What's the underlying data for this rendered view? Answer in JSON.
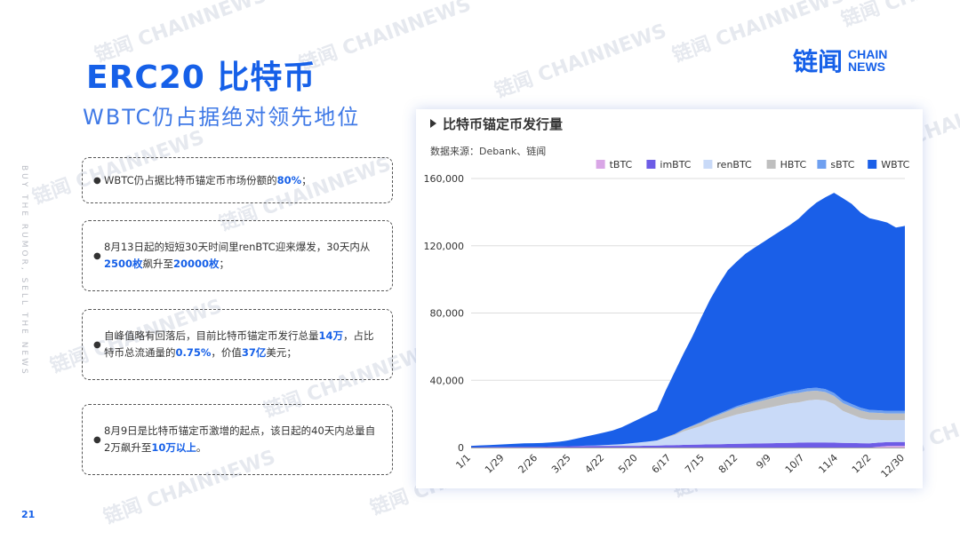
{
  "side_text": "BUY THE RUMOR, SELL THE NEWS",
  "watermark_text": "链闻 CHAINNEWS",
  "title": "ERC20 比特币",
  "subtitle": "WBTC仍占据绝对领先地位",
  "logo": {
    "cn": "链闻",
    "en_line1": "CHAIN",
    "en_line2": "NEWS"
  },
  "page_number": "21",
  "cards": [
    {
      "parts": [
        {
          "t": "WBTC仍占据比特币锚定币市场份额的"
        },
        {
          "t": "80%",
          "hl": true
        },
        {
          "t": "；"
        }
      ]
    },
    {
      "parts": [
        {
          "t": "8月13日起的短短30天时间里renBTC迎来爆发，30天内从"
        },
        {
          "t": "2500枚",
          "hl": true
        },
        {
          "t": "飙升至"
        },
        {
          "t": "20000枚",
          "hl": true
        },
        {
          "t": "；"
        }
      ]
    },
    {
      "parts": [
        {
          "t": "自峰值略有回落后，目前比特币锚定币发行总量"
        },
        {
          "t": "14万",
          "hl": true
        },
        {
          "t": "，占比特币总流通量的"
        },
        {
          "t": "0.75%",
          "hl": true
        },
        {
          "t": "，价值"
        },
        {
          "t": "37亿",
          "hl": true
        },
        {
          "t": "美元；"
        }
      ]
    },
    {
      "parts": [
        {
          "t": "8月9日是比特币锚定币激增的起点，该日起的40天内总量自2万飙升至"
        },
        {
          "t": "10万以上",
          "hl": true
        },
        {
          "t": "。"
        }
      ]
    }
  ],
  "chart_data": {
    "type": "area",
    "stacked": true,
    "title": "比特币锚定币发行量",
    "source": "数据来源：Debank、链闻",
    "legend_position": "top-right",
    "grid": true,
    "ylim": [
      0,
      160000
    ],
    "y_ticks": [
      "0",
      "40,000",
      "80,000",
      "120,000",
      "160,000"
    ],
    "x_tick_labels": [
      "1/1",
      "1/29",
      "2/26",
      "3/25",
      "4/22",
      "5/20",
      "6/17",
      "7/15",
      "8/12",
      "9/9",
      "10/7",
      "11/4",
      "12/2",
      "12/30"
    ],
    "x": [
      "1/1",
      "1/15",
      "1/29",
      "2/12",
      "2/26",
      "3/11",
      "3/25",
      "4/8",
      "4/22",
      "5/6",
      "5/20",
      "6/3",
      "6/10",
      "6/17",
      "6/24",
      "7/1",
      "7/8",
      "7/15",
      "7/22",
      "7/29",
      "8/5",
      "8/12",
      "8/16",
      "8/19",
      "8/23",
      "8/26",
      "8/30",
      "9/2",
      "9/6",
      "9/9",
      "9/13",
      "9/16",
      "9/20",
      "9/23",
      "9/27",
      "9/30",
      "10/4",
      "10/7",
      "10/14",
      "10/21",
      "10/28",
      "11/4",
      "11/11",
      "11/18",
      "11/25",
      "12/2",
      "12/9",
      "12/16",
      "12/23",
      "12/30"
    ],
    "series": [
      {
        "name": "tBTC",
        "color": "#d9a6e6",
        "values": [
          0,
          0,
          0,
          0,
          0,
          0,
          0,
          0,
          0,
          0,
          0,
          0,
          0,
          0,
          0,
          0,
          0,
          0,
          0,
          0,
          0,
          0,
          0,
          0,
          0,
          0,
          0,
          0,
          0,
          0,
          0,
          0,
          0,
          0,
          0,
          0,
          0,
          0,
          0,
          0,
          0,
          0,
          0,
          0,
          0,
          0,
          500,
          900,
          1000,
          1000
        ]
      },
      {
        "name": "imBTC",
        "color": "#6d5ce6",
        "values": [
          200,
          250,
          300,
          350,
          400,
          450,
          500,
          500,
          500,
          600,
          700,
          800,
          900,
          1000,
          1000,
          1000,
          1000,
          1000,
          1000,
          1000,
          1100,
          1200,
          1300,
          1400,
          1600,
          1700,
          1800,
          1900,
          2000,
          2100,
          2200,
          2300,
          2400,
          2500,
          2600,
          2700,
          2800,
          2900,
          3000,
          3000,
          3000,
          2900,
          2800,
          2700,
          2600,
          2500,
          2400,
          2300,
          2300,
          2300
        ]
      },
      {
        "name": "renBTC",
        "color": "#c9daf8",
        "values": [
          0,
          0,
          0,
          0,
          0,
          0,
          0,
          0,
          0,
          0,
          0,
          0,
          0,
          100,
          200,
          400,
          700,
          1000,
          1500,
          2000,
          2500,
          3000,
          4500,
          6000,
          8000,
          9500,
          11000,
          13000,
          14500,
          16000,
          17500,
          18500,
          19500,
          20500,
          21500,
          22500,
          23500,
          24000,
          25000,
          25500,
          25000,
          23000,
          19000,
          17000,
          15000,
          14000,
          13500,
          13000,
          13000,
          13000
        ]
      },
      {
        "name": "HBTC",
        "color": "#bfbfbf",
        "values": [
          0,
          0,
          0,
          0,
          0,
          0,
          0,
          0,
          0,
          0,
          0,
          0,
          0,
          0,
          0,
          0,
          0,
          0,
          0,
          0,
          0,
          0,
          200,
          500,
          1000,
          1500,
          2000,
          2500,
          3000,
          3500,
          4000,
          4500,
          4800,
          5000,
          5200,
          5400,
          5500,
          5600,
          5500,
          5300,
          5000,
          4800,
          4600,
          4500,
          4400,
          4300,
          4200,
          4100,
          4000,
          4000
        ]
      },
      {
        "name": "sBTC",
        "color": "#6fa0f0",
        "values": [
          0,
          0,
          0,
          0,
          0,
          0,
          0,
          0,
          0,
          0,
          0,
          0,
          0,
          0,
          0,
          0,
          0,
          0,
          0,
          0,
          0,
          0,
          100,
          200,
          300,
          400,
          500,
          600,
          700,
          800,
          900,
          1000,
          1100,
          1200,
          1300,
          1400,
          1500,
          1600,
          1700,
          1800,
          1800,
          1800,
          1800,
          1700,
          1700,
          1600,
          1600,
          1500,
          1500,
          1500
        ]
      },
      {
        "name": "WBTC",
        "color": "#1a5fe8",
        "values": [
          800,
          1000,
          1200,
          1400,
          1600,
          1800,
          2000,
          2100,
          2200,
          2400,
          2800,
          3500,
          4500,
          5500,
          6500,
          7500,
          8500,
          10000,
          12000,
          14000,
          16000,
          18000,
          28000,
          37000,
          45000,
          53000,
          62000,
          70000,
          77000,
          83000,
          86000,
          89000,
          91000,
          93000,
          95000,
          97000,
          99000,
          102000,
          106000,
          110000,
          114000,
          119000,
          120000,
          119000,
          116000,
          114000,
          113000,
          112000,
          109000,
          110000
        ]
      }
    ]
  }
}
